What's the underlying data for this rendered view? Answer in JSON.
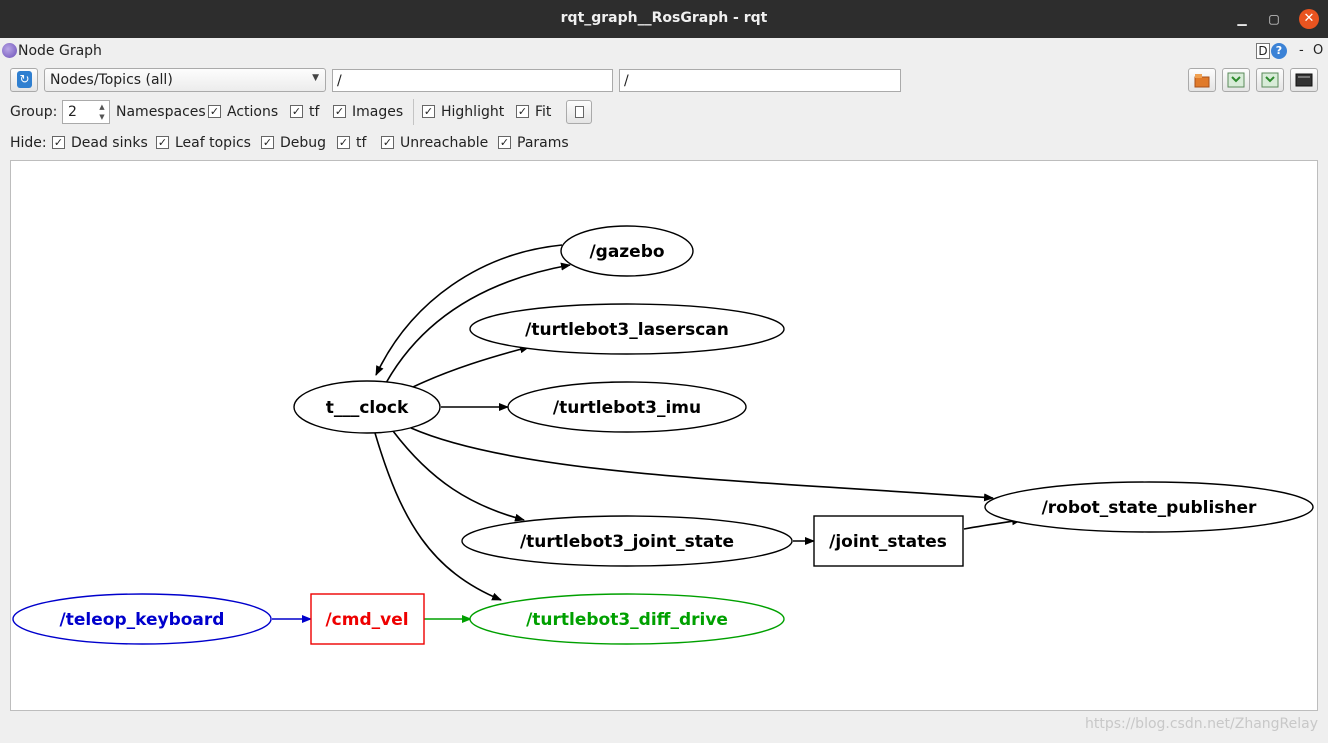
{
  "window": {
    "title": "rqt_graph__RosGraph - rqt",
    "minimize": "▁",
    "maximize": "▢",
    "close": "✕"
  },
  "plugin": {
    "title": "Node Graph",
    "help_d": "D",
    "help_q": "?",
    "dash": "-",
    "close": "O"
  },
  "toolbar": {
    "graph_type": "Nodes/Topics (all)",
    "filter_nodes": "/",
    "filter_topics": "/",
    "icons": [
      "open-file-icon",
      "save-dot-icon",
      "save-svg-icon",
      "screenshot-icon"
    ]
  },
  "options": {
    "group_label": "Group:",
    "group_value": "2",
    "namespaces": "Namespaces",
    "actions": "Actions",
    "tf": "tf",
    "images": "Images",
    "highlight": "Highlight",
    "fit": "Fit"
  },
  "hide": {
    "label": "Hide:",
    "dead_sinks": "Dead sinks",
    "leaf_topics": "Leaf topics",
    "debug": "Debug",
    "tf": "tf",
    "unreachable": "Unreachable",
    "params": "Params"
  },
  "graph": {
    "nodes": {
      "gazebo": "/gazebo",
      "laserscan": "/turtlebot3_laserscan",
      "clock": "t___clock",
      "imu": "/turtlebot3_imu",
      "robot_state_publisher": "/robot_state_publisher",
      "joint_state": "/turtlebot3_joint_state",
      "joint_states": "/joint_states",
      "teleop_keyboard": "/teleop_keyboard",
      "cmd_vel": "/cmd_vel",
      "diff_drive": "/turtlebot3_diff_drive"
    },
    "colors": {
      "default": "#000000",
      "teleop": "#0000cc",
      "cmd_vel": "#ee0000",
      "diff_drive": "#00a000"
    }
  },
  "watermark": "https://blog.csdn.net/ZhangRelay"
}
